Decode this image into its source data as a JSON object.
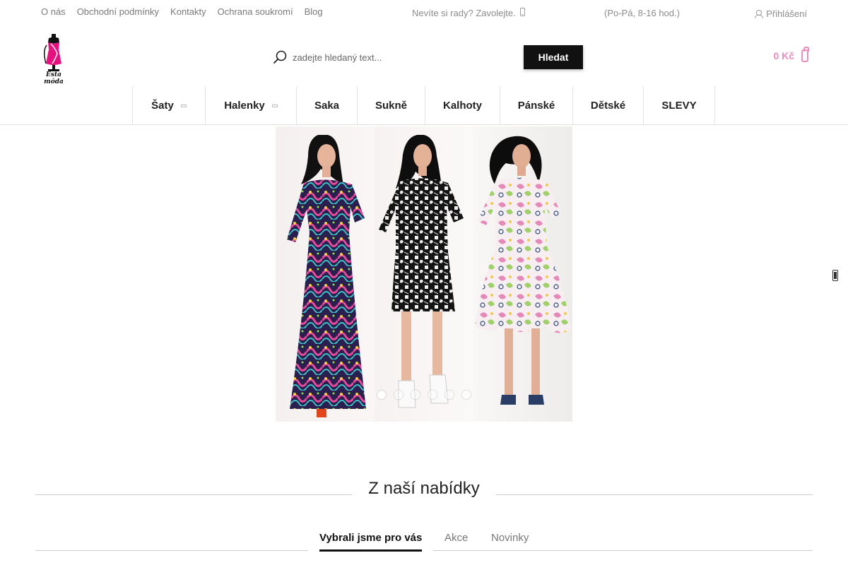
{
  "top_links": [
    "O nás",
    "Obchodní podmínky",
    "Kontakty",
    "Ochrana soukromí",
    "Blog"
  ],
  "contact_text": "Nevíte si rady? Zavolejte.",
  "hours": "(Po-Pá, 8-16 hod.)",
  "login_label": "Přihlášení",
  "logo_text": "Esta móda",
  "search": {
    "placeholder": "zadejte hledaný text...",
    "button": "Hledat"
  },
  "cart": {
    "price": "0 Kč"
  },
  "nav": [
    {
      "label": "Šaty",
      "submenu": true
    },
    {
      "label": "Halenky",
      "submenu": true
    },
    {
      "label": "Saka",
      "submenu": false
    },
    {
      "label": "Sukně",
      "submenu": false
    },
    {
      "label": "Kalhoty",
      "submenu": false
    },
    {
      "label": "Pánské",
      "submenu": false
    },
    {
      "label": "Dětské",
      "submenu": false
    },
    {
      "label": "SLEVY",
      "submenu": false
    }
  ],
  "slider": {
    "slide_count": 6,
    "active_index": 0
  },
  "section_title": "Z naší nabídky",
  "tabs": [
    {
      "label": "Vybrali jsme pro vás",
      "active": true
    },
    {
      "label": "Akce",
      "active": false
    },
    {
      "label": "Novinky",
      "active": false
    }
  ],
  "colors": {
    "accent": "#e98bbd",
    "button": "#111111",
    "logo_pink": "#e6107e"
  }
}
